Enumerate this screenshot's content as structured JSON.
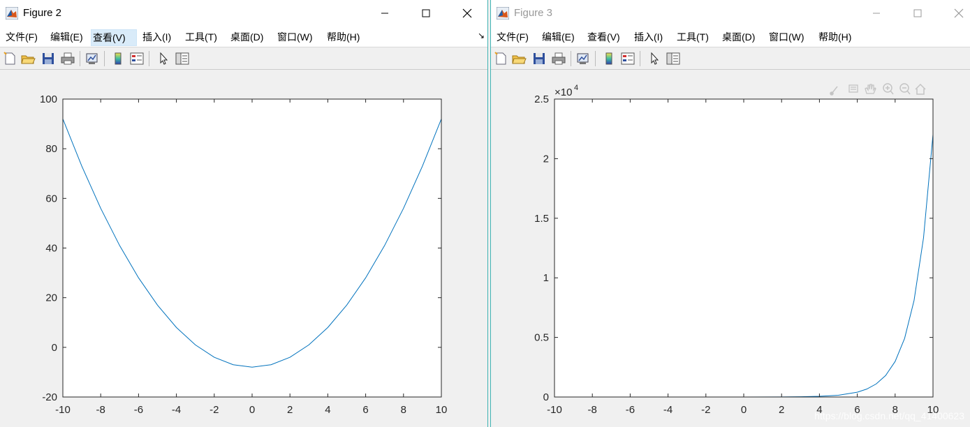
{
  "colors": {
    "line": "#0072bd",
    "accent": "#3fb3b3",
    "menu_active_bg": "#d9ebf9"
  },
  "windows": [
    {
      "title": "Figure 2",
      "menu": [
        "文件(F)",
        "编辑(E)",
        "查看(V)",
        "插入(I)",
        "工具(T)",
        "桌面(D)",
        "窗口(W)",
        "帮助(H)"
      ],
      "active_menu_index": 2,
      "toolbar_icons": [
        "new-figure-icon",
        "open-file-icon",
        "save-icon",
        "print-icon",
        "link-plot-icon",
        "colorbar-icon",
        "legend-icon",
        "edit-plot-icon",
        "property-inspector-icon"
      ]
    },
    {
      "title": "Figure 3",
      "menu": [
        "文件(F)",
        "编辑(E)",
        "查看(V)",
        "插入(I)",
        "工具(T)",
        "桌面(D)",
        "窗口(W)",
        "帮助(H)"
      ],
      "active_menu_index": -1,
      "toolbar_icons": [
        "new-figure-icon",
        "open-file-icon",
        "save-icon",
        "print-icon",
        "link-plot-icon",
        "colorbar-icon",
        "legend-icon",
        "edit-plot-icon",
        "property-inspector-icon"
      ],
      "axes_toolbar_icons": [
        "brush-icon",
        "datatip-icon",
        "pan-icon",
        "zoom-in-icon",
        "zoom-out-icon",
        "home-icon"
      ]
    }
  ],
  "watermark": "https://blog.csdn.net/qq_41400623",
  "chart_data": [
    {
      "type": "line",
      "title": "",
      "xlabel": "",
      "ylabel": "",
      "xlim": [
        -10,
        10
      ],
      "ylim": [
        -20,
        100
      ],
      "xticks": [
        -10,
        -8,
        -6,
        -4,
        -2,
        0,
        2,
        4,
        6,
        8,
        10
      ],
      "yticks": [
        -20,
        0,
        20,
        40,
        60,
        80,
        100
      ],
      "xtick_labels": [
        "-10",
        "-8",
        "-6",
        "-4",
        "-2",
        "0",
        "2",
        "4",
        "6",
        "8",
        "10"
      ],
      "ytick_labels": [
        "-20",
        "0",
        "20",
        "40",
        "60",
        "80",
        "100"
      ],
      "series": [
        {
          "x": [
            -10,
            -9,
            -8,
            -7,
            -6,
            -5,
            -4,
            -3,
            -2,
            -1,
            0,
            1,
            2,
            3,
            4,
            5,
            6,
            7,
            8,
            9,
            10
          ],
          "values": [
            92,
            73,
            56,
            41,
            28,
            17,
            8,
            1,
            -4,
            -7,
            -8,
            -7,
            -4,
            1,
            8,
            17,
            28,
            41,
            56,
            73,
            92
          ]
        }
      ]
    },
    {
      "type": "line",
      "title": "",
      "xlabel": "",
      "ylabel": "",
      "exponent_label": "×10",
      "exponent_power": "4",
      "xlim": [
        -10,
        10
      ],
      "ylim": [
        0,
        2.5
      ],
      "xticks": [
        -10,
        -8,
        -6,
        -4,
        -2,
        0,
        2,
        4,
        6,
        8,
        10
      ],
      "yticks": [
        0,
        0.5,
        1,
        1.5,
        2,
        2.5
      ],
      "xtick_labels": [
        "-10",
        "-8",
        "-6",
        "-4",
        "-2",
        "0",
        "2",
        "4",
        "6",
        "8",
        "10"
      ],
      "ytick_labels": [
        "0",
        "0.5",
        "1",
        "1.5",
        "2",
        "2.5"
      ],
      "series": [
        {
          "x": [
            -10,
            -8,
            -6,
            -4,
            -2,
            0,
            2,
            3,
            4,
            5,
            6,
            6.5,
            7,
            7.5,
            8,
            8.5,
            9,
            9.5,
            10
          ],
          "values": [
            0,
            0,
            0,
            0,
            0,
            0,
            0.0007,
            0.002,
            0.0055,
            0.0148,
            0.0403,
            0.0665,
            0.1097,
            0.1808,
            0.2981,
            0.4915,
            0.8103,
            1.336,
            2.2026
          ]
        }
      ]
    }
  ]
}
